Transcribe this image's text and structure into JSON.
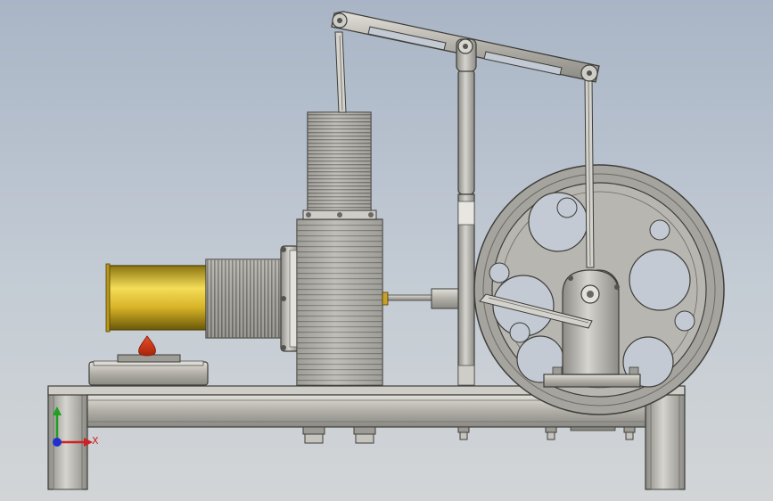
{
  "viewport": {
    "background_top": "#a9b5c6",
    "background_bottom": "#d2d5d6"
  },
  "model": {
    "parts": [
      "base-frame",
      "burner-dish",
      "flame",
      "brass-cylinder",
      "finned-heat-exchanger",
      "cylinder-flange",
      "main-cylinder-block",
      "power-cylinder",
      "walking-beam",
      "beam-pivot-column",
      "connecting-rods",
      "displacer-rod",
      "guide-post",
      "flywheel",
      "crank-bearing-stand",
      "mounting-bolts"
    ],
    "colors": {
      "steel": "#b4b2aa",
      "steel_dark": "#5c5b56",
      "brass": "#d8b428",
      "flame": "#d23a14"
    }
  },
  "triad": {
    "x_label": "X",
    "x_color": "#d02020",
    "y_color": "#20a020",
    "z_color": "#2030d0"
  }
}
